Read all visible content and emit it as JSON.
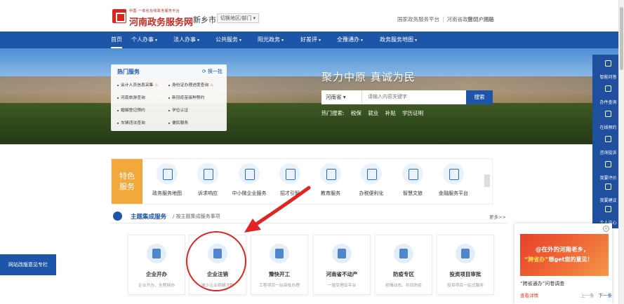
{
  "header": {
    "logo_sub": "中国·一体化在线政务服务平台",
    "logo_title": "河南政务服务网",
    "city": "新乡市",
    "switch_label": "切换地区/部门",
    "links": [
      "国家政务服务平台",
      "河南省政府门户网站"
    ],
    "login": "登录",
    "register": "注册"
  },
  "nav": {
    "items": [
      {
        "label": "首页",
        "dropdown": false
      },
      {
        "label": "个人办事",
        "dropdown": true
      },
      {
        "label": "法人办事",
        "dropdown": true
      },
      {
        "label": "公共服务",
        "dropdown": true
      },
      {
        "label": "阳光政务",
        "dropdown": true
      },
      {
        "label": "好差评",
        "dropdown": true
      },
      {
        "label": "全豫通办",
        "dropdown": true
      },
      {
        "label": "政务服务地图",
        "dropdown": true
      }
    ]
  },
  "hot_services": {
    "title": "热门服务",
    "refresh": "换一批",
    "items": [
      {
        "label": "会计人员信息采集",
        "hot": true
      },
      {
        "label": "身份证办理进度查询",
        "hot": true
      },
      {
        "label": "河南旅游查询",
        "hot": false
      },
      {
        "label": "新冠疫苗接种预约",
        "hot": false
      },
      {
        "label": "婚姻登记预约",
        "hot": false
      },
      {
        "label": "学位认证",
        "hot": false
      },
      {
        "label": "车辆违法查询",
        "hot": false
      },
      {
        "label": "便民服务",
        "hot": false
      }
    ]
  },
  "banner": {
    "slogan": "聚力中原 真诚为民",
    "search_region": "河南省",
    "search_placeholder": "请输入内容关键字",
    "search_button": "搜索",
    "hot_search_label": "热门搜索:",
    "hot_search": [
      "税保",
      "就业",
      "补贴",
      "学历证明"
    ]
  },
  "special": {
    "tag": "特色服务",
    "items": [
      "政务服务地图",
      "诉求响应",
      "中小微企业服务",
      "招才引智",
      "教育服务",
      "办税便利化",
      "智慧文旅",
      "金融服务平台"
    ]
  },
  "theme": {
    "title": "主题集成服务",
    "subtitle": "/ 按主题集成服务事项",
    "more": "更多>>",
    "cards": [
      {
        "title": "企业开办",
        "desc": "企业开办、全程网办"
      },
      {
        "title": "企业注销",
        "desc": "减少企业跑腿次数"
      },
      {
        "title": "豫快开工",
        "desc": "工程项目一站审批办理"
      },
      {
        "title": "河南省不动产",
        "desc": "一窗受理云平台"
      },
      {
        "title": "防疫专区",
        "desc": "疫情动态、共同防疫"
      },
      {
        "title": "投资项目审批",
        "desc": "投资项目一站式服务"
      }
    ]
  },
  "feedback": {
    "label": "网站改版意见专栏"
  },
  "right_bar": {
    "items": [
      "智能问答",
      "办件查询",
      "在线预约",
      "咨询投诉",
      "我要评价",
      "我要建议",
      "个人中心"
    ]
  },
  "promo": {
    "line1": "@在外的河南老乡，",
    "line2_a": "“跨省办”",
    "line2_b": "想get您的意见！",
    "caption": "“跨省通办”问卷调查",
    "foot": "查看详情",
    "prev": "上一条",
    "next": "下一条"
  },
  "colors": {
    "brand_blue": "#1d56a8",
    "brand_red": "#d9251d",
    "special_orange": "#f2a83b",
    "highlight_red": "#e02424"
  }
}
